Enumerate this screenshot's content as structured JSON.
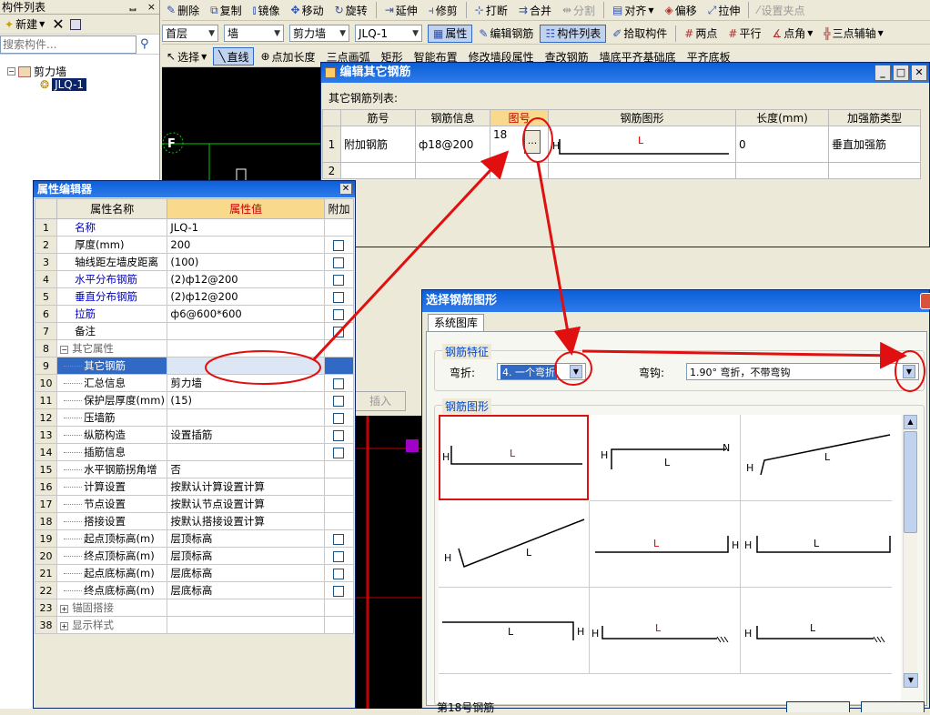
{
  "component_list": {
    "title": "构件列表",
    "pin": "ᆸ",
    "close": "×",
    "new_label": "新建",
    "search_placeholder": "搜索构件...",
    "tree": {
      "root": "剪力墙",
      "child": "JLQ-1"
    }
  },
  "toolbar1": {
    "delete": "删除",
    "copy": "复制",
    "mirror": "镜像",
    "move": "移动",
    "rotate": "旋转",
    "extend": "延伸",
    "trim": "修剪",
    "break": "打断",
    "merge": "合并",
    "split": "分割",
    "align": "对齐",
    "offset": "偏移",
    "stretch": "拉伸",
    "set_grip": "设置夹点"
  },
  "toolbar2": {
    "floor": "首层",
    "type": "墙",
    "subtype": "剪力墙",
    "comp": "JLQ-1",
    "attr": "属性",
    "edit_rebar": "编辑钢筋",
    "comp_list": "构件列表",
    "pick": "拾取构件",
    "two_point": "两点",
    "parallel": "平行",
    "point_angle": "点角",
    "three_point_aux": "三点辅轴"
  },
  "toolbar3": {
    "select": "选择",
    "line": "直线",
    "point_len": "点加长度",
    "three_arc": "三点画弧",
    "rect": "矩形",
    "smart": "智能布置",
    "modify_seg": "修改墙段属性",
    "view_rebar": "查改钢筋",
    "extend_below": "墙底平齐基础底",
    "flush": "平齐底板"
  },
  "cad": {
    "axis_label": "F"
  },
  "property_editor": {
    "title": "属性编辑器",
    "headers": [
      "属性名称",
      "属性值",
      "附加"
    ],
    "rows": [
      {
        "no": "1",
        "name": "名称",
        "value": "JLQ-1",
        "style": "blue",
        "cb": false
      },
      {
        "no": "2",
        "name": "厚度(mm)",
        "value": "200",
        "style": "normal",
        "cb": true
      },
      {
        "no": "3",
        "name": "轴线距左墙皮距离",
        "value": "(100)",
        "style": "normal",
        "cb": true
      },
      {
        "no": "4",
        "name": "水平分布钢筋",
        "value": "(2)ф12@200",
        "style": "blue",
        "cb": true
      },
      {
        "no": "5",
        "name": "垂直分布钢筋",
        "value": "(2)ф12@200",
        "style": "blue",
        "cb": true
      },
      {
        "no": "6",
        "name": "拉筋",
        "value": "ф6@600*600",
        "style": "blue",
        "cb": true
      },
      {
        "no": "7",
        "name": "备注",
        "value": "",
        "style": "normal",
        "cb": true
      },
      {
        "no": "8",
        "name": "其它属性",
        "value": "",
        "style": "group",
        "cb": false
      },
      {
        "no": "9",
        "name": "其它钢筋",
        "value": "",
        "style": "selected",
        "cb": false
      },
      {
        "no": "10",
        "name": "汇总信息",
        "value": "剪力墙",
        "style": "child",
        "cb": true
      },
      {
        "no": "11",
        "name": "保护层厚度(mm)",
        "value": "(15)",
        "style": "child",
        "cb": true
      },
      {
        "no": "12",
        "name": "压墙筋",
        "value": "",
        "style": "child",
        "cb": true
      },
      {
        "no": "13",
        "name": "纵筋构造",
        "value": "设置插筋",
        "style": "child",
        "cb": true
      },
      {
        "no": "14",
        "name": "插筋信息",
        "value": "",
        "style": "child",
        "cb": true
      },
      {
        "no": "15",
        "name": "水平钢筋拐角增",
        "value": "否",
        "style": "child",
        "cb": false
      },
      {
        "no": "16",
        "name": "计算设置",
        "value": "按默认计算设置计算",
        "style": "child",
        "cb": false
      },
      {
        "no": "17",
        "name": "节点设置",
        "value": "按默认节点设置计算",
        "style": "child",
        "cb": false
      },
      {
        "no": "18",
        "name": "搭接设置",
        "value": "按默认搭接设置计算",
        "style": "child",
        "cb": false
      },
      {
        "no": "19",
        "name": "起点顶标高(m)",
        "value": "层顶标高",
        "style": "child",
        "cb": true
      },
      {
        "no": "20",
        "name": "终点顶标高(m)",
        "value": "层顶标高",
        "style": "child",
        "cb": true
      },
      {
        "no": "21",
        "name": "起点底标高(m)",
        "value": "层底标高",
        "style": "child",
        "cb": true
      },
      {
        "no": "22",
        "name": "终点底标高(m)",
        "value": "层底标高",
        "style": "child",
        "cb": true
      },
      {
        "no": "23",
        "name": "锚固搭接",
        "value": "",
        "style": "group",
        "cb": false
      },
      {
        "no": "38",
        "name": "显示样式",
        "value": "",
        "style": "group",
        "cb": false
      }
    ]
  },
  "edit_rebar": {
    "title": "编辑其它钢筋",
    "list_label": "其它钢筋列表:",
    "headers": [
      "筋号",
      "钢筋信息",
      "图号",
      "钢筋图形",
      "长度(mm)",
      "加强筋类型"
    ],
    "row1": {
      "no": "1",
      "name": "附加钢筋",
      "info": "ф18@200",
      "fig": "18",
      "ellipsis": "...",
      "h": "H",
      "l": "L",
      "length": "0",
      "type": "垂直加强筋"
    },
    "row2_no": "2",
    "insert": "插入"
  },
  "select_shape": {
    "title": "选择钢筋图形",
    "tab": "系统图库",
    "feature_group": "钢筋特征",
    "bend_label": "弯折:",
    "bend_value": "4. 一个弯折",
    "hook_label": "弯钩:",
    "hook_value": "1.90° 弯折，不带弯钩",
    "shapes_group": "钢筋图形",
    "status": "第18号钢筋",
    "shape_labels": {
      "h": "H",
      "l": "L",
      "n": "N"
    }
  }
}
